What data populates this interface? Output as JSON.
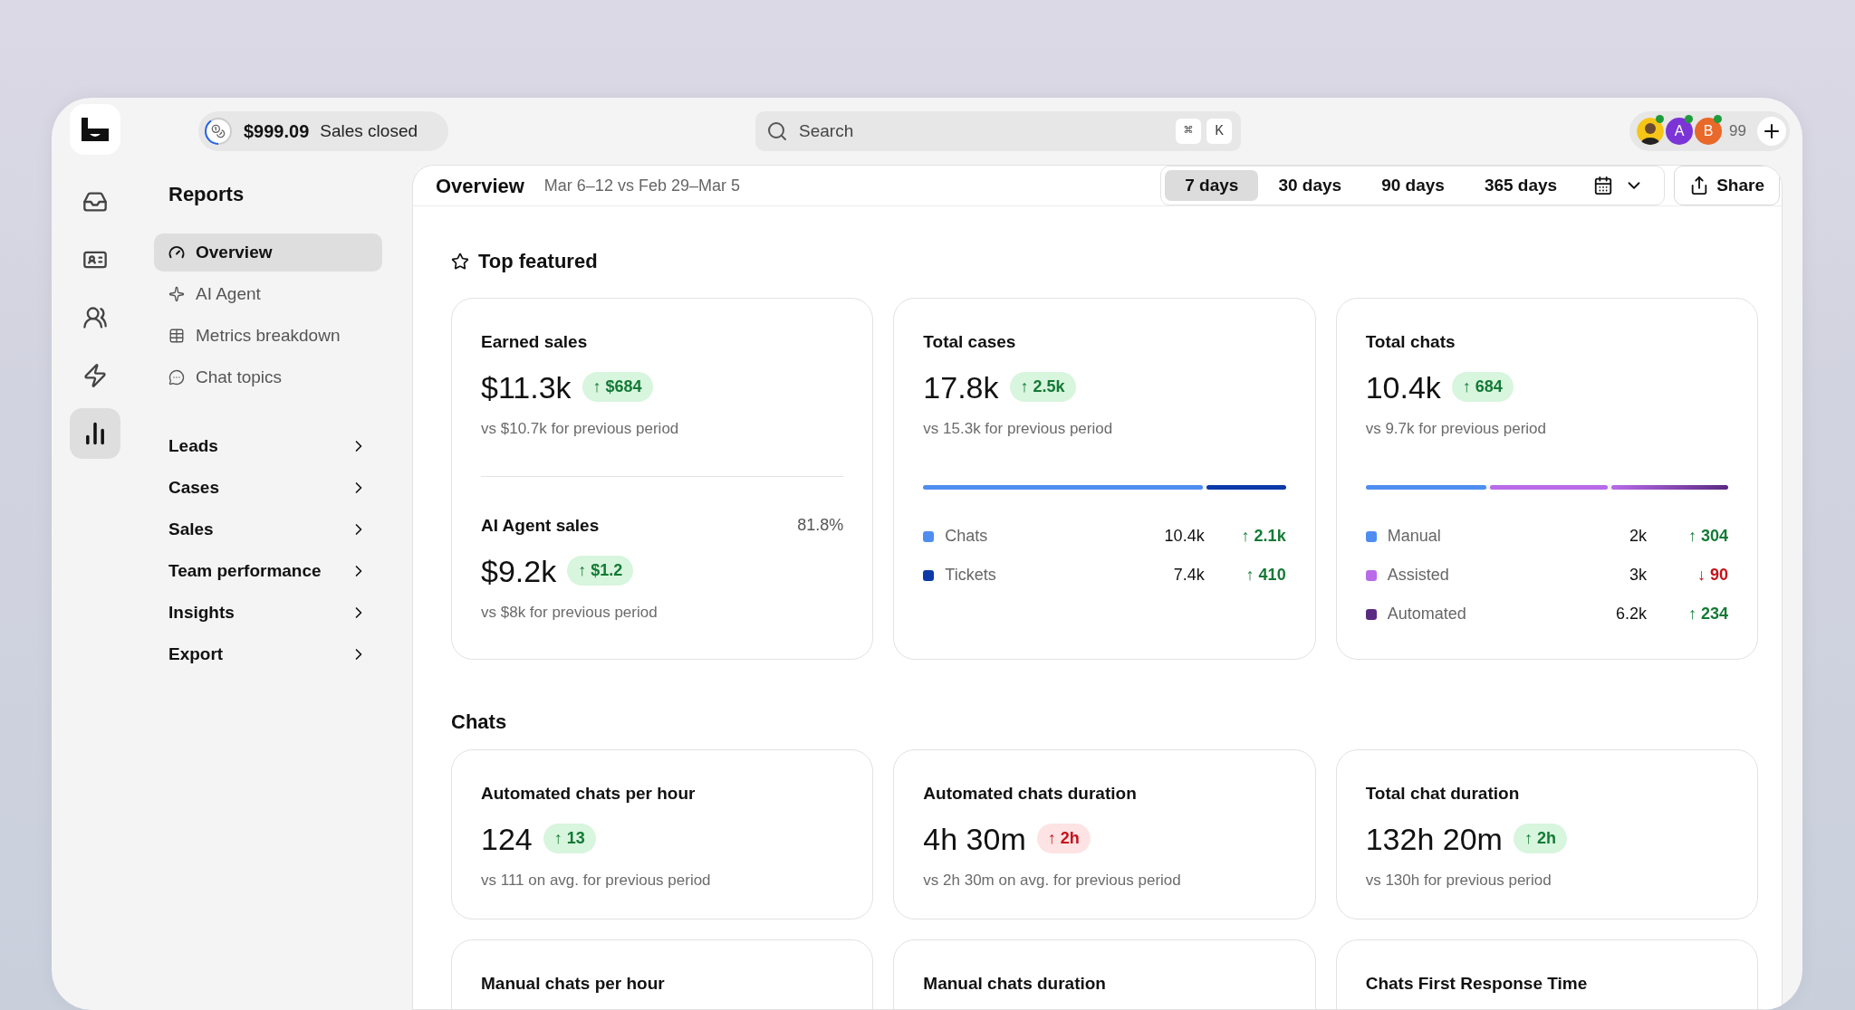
{
  "rail": [
    {
      "selected": false
    },
    {
      "selected": false
    },
    {
      "selected": false
    },
    {
      "selected": false
    },
    {
      "selected": true
    }
  ],
  "sales_pill": {
    "amount": "$999.09",
    "label": "Sales closed",
    "level": 0.4
  },
  "search": {
    "placeholder": "Search",
    "keys": [
      "⌘",
      "K"
    ]
  },
  "avatars": [
    {
      "kind": "picture",
      "color": "#f5c518",
      "online": true
    },
    {
      "kind": "initial",
      "initial": "A",
      "color": "#7b35d6",
      "online": true
    },
    {
      "kind": "initial",
      "initial": "B",
      "color": "#e8692a",
      "online": true
    }
  ],
  "avatar_count": "99",
  "sidebar": {
    "title": "Reports",
    "items": [
      {
        "label": "Overview",
        "selected": true
      },
      {
        "label": "AI Agent",
        "selected": false
      },
      {
        "label": "Metrics breakdown",
        "selected": false
      },
      {
        "label": "Chat topics",
        "selected": false
      }
    ],
    "groups": [
      {
        "label": "Leads",
        "expanded": false
      },
      {
        "label": "Cases",
        "expanded": false
      },
      {
        "label": "Sales",
        "expanded": false
      },
      {
        "label": "Team performance",
        "expanded": false
      },
      {
        "label": "Insights",
        "expanded": false
      },
      {
        "label": "Export",
        "expanded": false
      }
    ]
  },
  "header": {
    "title": "Overview",
    "range": "Mar 6–12 vs Feb 29–Mar 5",
    "tabs": [
      {
        "label": "7 days",
        "selected": true
      },
      {
        "label": "30 days",
        "selected": false
      },
      {
        "label": "90 days",
        "selected": false
      },
      {
        "label": "365 days",
        "selected": false
      }
    ],
    "share": "Share"
  },
  "top_featured": {
    "title": "Top featured",
    "cards": [
      {
        "kind": "split",
        "sections": [
          {
            "title": "Earned sales",
            "value": "$11.3k",
            "delta": {
              "text": "↑ $684",
              "negative": false
            },
            "comparison": "vs $10.7k for previous period"
          },
          {
            "title": "AI Agent sales",
            "share": "81.8%",
            "value": "$9.2k",
            "delta": {
              "text": "↑ $1.2",
              "negative": false
            },
            "comparison": "vs $8k for previous period"
          }
        ]
      },
      {
        "kind": "breakdown",
        "title": "Total cases",
        "value": "17.8k",
        "delta": {
          "text": "↑ 2.5k",
          "negative": false
        },
        "comparison": "vs 15.3k for previous period",
        "segments": [
          {
            "label": "Chats",
            "color": "#4f8ef0",
            "level": 0.77,
            "value": "10.4k",
            "delta": {
              "text": "↑ 2.1k",
              "negative": false
            }
          },
          {
            "label": "Tickets",
            "color": "#0b3aa8",
            "level": 0.23,
            "value": "7.4k",
            "delta": {
              "text": "↑ 410",
              "negative": false
            }
          }
        ]
      },
      {
        "kind": "breakdown",
        "title": "Total chats",
        "value": "10.4k",
        "delta": {
          "text": "↑ 684",
          "negative": false
        },
        "comparison": "vs 9.7k for previous period",
        "segments": [
          {
            "label": "Manual",
            "color": "#4f8ef0",
            "value": "2k",
            "delta": {
              "text": "↑ 304",
              "negative": false
            }
          },
          {
            "label": "Assisted",
            "color": "#b86ae8",
            "value": "3k",
            "delta": {
              "text": "↓ 90",
              "negative": true
            }
          },
          {
            "label": "Automated",
            "color": "#5a2a82",
            "value": "6.2k",
            "delta": {
              "text": "↑ 234",
              "negative": false
            }
          }
        ]
      }
    ]
  },
  "chats": {
    "title": "Chats",
    "cards": [
      {
        "title": "Automated chats per hour",
        "value": "124",
        "delta": {
          "text": "↑ 13",
          "negative": false
        },
        "comparison": "vs 111 on avg. for previous period"
      },
      {
        "title": "Automated chats duration",
        "value": "4h 30m",
        "delta": {
          "text": "↑ 2h",
          "negative": true
        },
        "comparison": "vs 2h 30m on avg. for previous period"
      },
      {
        "title": "Total chat duration",
        "value": "132h 20m",
        "delta": {
          "text": "↑ 2h",
          "negative": false
        },
        "comparison": "vs 130h for previous period"
      },
      {
        "title": "Manual chats per hour"
      },
      {
        "title": "Manual chats duration"
      },
      {
        "title": "Chats First Response Time"
      }
    ]
  }
}
